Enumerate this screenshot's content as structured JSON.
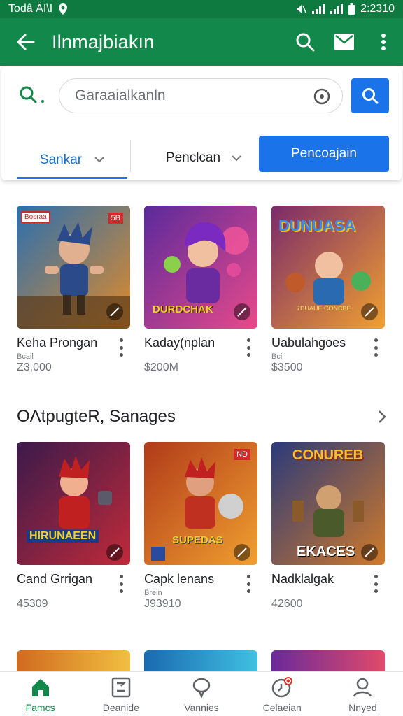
{
  "status_bar": {
    "left_text": "Todâ ÄI\\I",
    "time": "2:2310"
  },
  "app_bar": {
    "title": "Ilnmajbiakın"
  },
  "search": {
    "value": "Garaaialkanln",
    "filter_tab_1": "Sankar",
    "filter_tab_2": "Penclcan",
    "filter_button": "Pencoajain"
  },
  "row1": [
    {
      "name": "Keha Prongan",
      "sub": "Bcail",
      "price": "Z3,000",
      "badge": "Bosraa",
      "corner_badge": "5B",
      "colors": [
        "#2a6fb0",
        "#e08a2a"
      ]
    },
    {
      "name": "Kaday(nplan",
      "sub": "",
      "price": "$200M",
      "art_text": "DURDCHAK",
      "colors": [
        "#5a2a9a",
        "#e84a8a"
      ]
    },
    {
      "name": "Uabulahgoes",
      "sub": "Bcil",
      "price": "$3500",
      "art_text": "DUNUASA",
      "art_subtext": "7DUAUE CONCBE",
      "colors": [
        "#7a2a6a",
        "#f0a030"
      ]
    }
  ],
  "section2": {
    "title": "OΛtpugteR, Sanages"
  },
  "row2": [
    {
      "name": "Cand Grrigan",
      "sub": "",
      "price": "45309",
      "art_text": "HIRUNAEEN",
      "colors": [
        "#3a1a4a",
        "#c02a3a"
      ]
    },
    {
      "name": "Capk lenans",
      "sub": "Brein",
      "price": "J93910",
      "corner_badge": "ND",
      "art_text": "SUPEDAS",
      "colors": [
        "#b03a1a",
        "#f0a030"
      ]
    },
    {
      "name": "Nadklalgak",
      "sub": "",
      "price": "42600",
      "art_text": "CONUREB",
      "art_subtext": "EKACES",
      "colors": [
        "#2a3a7a",
        "#d07a2a"
      ]
    }
  ],
  "row3_colors": [
    [
      "#d06a20",
      "#f0c040"
    ],
    [
      "#1a6ab0",
      "#40c0e0"
    ],
    [
      "#6a2a9a",
      "#e04a6a"
    ]
  ],
  "bottom_nav": [
    {
      "label": "Famcs",
      "icon": "home-icon",
      "active": true
    },
    {
      "label": "Deanide",
      "icon": "card-icon",
      "active": false
    },
    {
      "label": "Vannies",
      "icon": "balloon-icon",
      "active": false
    },
    {
      "label": "Celaeian",
      "icon": "clock-icon",
      "active": false
    },
    {
      "label": "Nnyed",
      "icon": "profile-icon",
      "active": false
    }
  ],
  "colors": {
    "app_bar": "#12894a",
    "accent_blue": "#1a73e8",
    "active_nav": "#12894a"
  }
}
